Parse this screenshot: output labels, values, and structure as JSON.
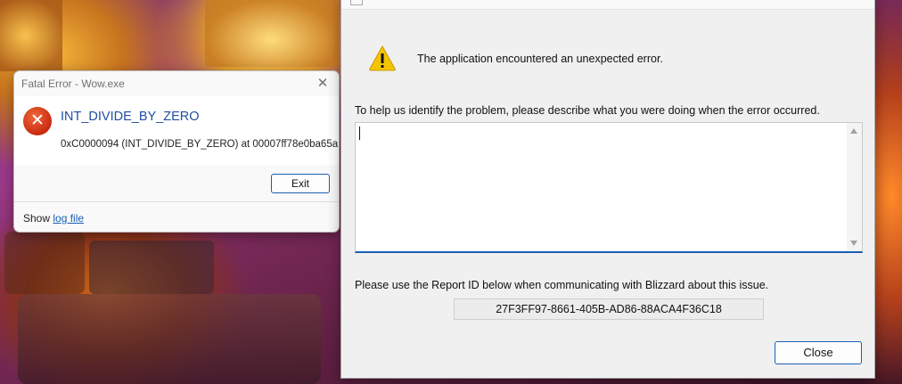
{
  "fatal_dialog": {
    "title": "Fatal Error - Wow.exe",
    "close_glyph": "✕",
    "error_icon": "error-x-icon",
    "error_glyph": "✕",
    "heading": "INT_DIVIDE_BY_ZERO",
    "detail": "0xC0000094 (INT_DIVIDE_BY_ZERO) at 00007ff78e0ba65a",
    "exit_label": "Exit",
    "footer_prefix": "Show ",
    "log_link": "log file"
  },
  "report_dialog": {
    "warning_icon": "warning-triangle-icon",
    "message": "The application encountered an unexpected error.",
    "help_text": "To help us identify the problem, please describe what you were doing when the error occurred.",
    "description_value": "",
    "report_id_label": "Please use the Report ID below when communicating with Blizzard about this issue.",
    "report_id": "27F3FF97-8661-405B-AD86-88ACA4F36C18",
    "close_label": "Close"
  },
  "colors": {
    "accent": "#1a5fb4",
    "error_red": "#c92a10",
    "warning_yellow": "#f5c400"
  }
}
